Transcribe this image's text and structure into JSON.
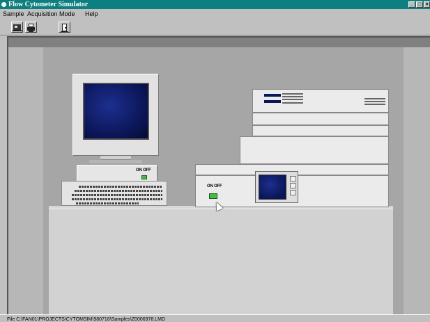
{
  "window": {
    "title": "Flow Cytometer Simulator",
    "controls": {
      "minimize": "_",
      "maximize": "□",
      "close": "×"
    }
  },
  "menu": {
    "items": [
      "Sample",
      "Acquisition Mode",
      "Help"
    ]
  },
  "toolbar": {
    "icons": [
      "instrument-icon",
      "printer-icon",
      "exit-door-icon"
    ]
  },
  "scene": {
    "computer_power_label": "ON OFF",
    "instrument_power_label": "ON OFF",
    "colors": {
      "screen": "#0b1658",
      "led_on": "#3fbf3f",
      "titlebar": "#0d7f80"
    }
  },
  "status": {
    "file_path": "File C:\\FAN01\\PROJECTS\\CYTOMSIM\\980716\\Samples\\Z0006978.LMD"
  }
}
